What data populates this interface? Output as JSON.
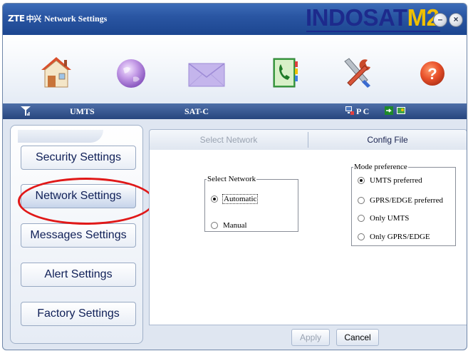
{
  "title_bar": {
    "brand": "ZTE",
    "brand_cn": "中兴",
    "title": "Network Settings",
    "logo_main": "INDOSAT",
    "logo_accent": "M2",
    "minimize_symbol": "–",
    "close_symbol": "×"
  },
  "toolbar": {
    "icons": [
      "home-icon",
      "internet-globe-icon",
      "messages-envelope-icon",
      "phonebook-icon",
      "settings-tools-icon",
      "help-icon"
    ]
  },
  "status_bar": {
    "signal_type": "UMTS",
    "operator": "SAT-C",
    "pc_label": "P C"
  },
  "sidebar": {
    "items": [
      {
        "label": "Security Settings"
      },
      {
        "label": "Network Settings",
        "active": true
      },
      {
        "label": "Messages Settings"
      },
      {
        "label": "Alert Settings"
      },
      {
        "label": "Factory Settings"
      }
    ]
  },
  "tabs": [
    {
      "label": "Select Network",
      "enabled": false
    },
    {
      "label": "Config File",
      "enabled": true
    }
  ],
  "select_network": {
    "legend": "Select Network",
    "options": [
      {
        "label": "Automatic",
        "checked": true
      },
      {
        "label": "Manual",
        "checked": false
      }
    ]
  },
  "mode_preference": {
    "legend": "Mode preference",
    "options": [
      {
        "label": "UMTS  preferred",
        "checked": true
      },
      {
        "label": "GPRS/EDGE preferred",
        "checked": false
      },
      {
        "label": "Only UMTS",
        "checked": false
      },
      {
        "label": "Only GPRS/EDGE",
        "checked": false
      }
    ]
  },
  "buttons": {
    "apply": "Apply",
    "cancel": "Cancel"
  },
  "colors": {
    "title_bar": "#2a56a3",
    "logo_main": "#1d2a8c",
    "logo_accent": "#f0c000",
    "highlight_ellipse": "#e01818"
  }
}
